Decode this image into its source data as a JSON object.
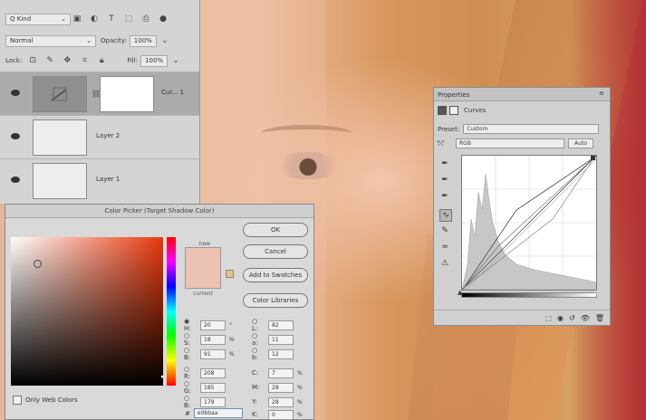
{
  "layers_panel": {
    "filter_kind": "Q Kind",
    "blend_mode": "Normal",
    "opacity_label": "Opacity:",
    "opacity_value": "100%",
    "lock_label": "Lock:",
    "fill_label": "Fill:",
    "fill_value": "100%",
    "layers": [
      {
        "name": "Cur... 1"
      },
      {
        "name": "Layer 2"
      },
      {
        "name": "Layer 1"
      }
    ]
  },
  "color_picker": {
    "title": "Color Picker (Target Shadow Color)",
    "new_label": "new",
    "current_label": "current",
    "ok": "OK",
    "cancel": "Cancel",
    "add_swatches": "Add to Swatches",
    "color_libraries": "Color Libraries",
    "only_web_colors": "Only Web Colors",
    "values": {
      "H": "20",
      "S": "18",
      "B": "91",
      "R": "208",
      "G": "185",
      "Bb": "179",
      "L": "82",
      "a": "11",
      "b": "12",
      "C": "7",
      "M": "28",
      "Y": "28",
      "K": "0"
    },
    "hex": "e0bbaa",
    "new_color": "#ecc3b3"
  },
  "properties_panel": {
    "tab": "Properties",
    "subtitle": "Curves",
    "preset_label": "Preset:",
    "preset_value": "Custom",
    "channel_value": "RGB",
    "auto_label": "Auto"
  }
}
